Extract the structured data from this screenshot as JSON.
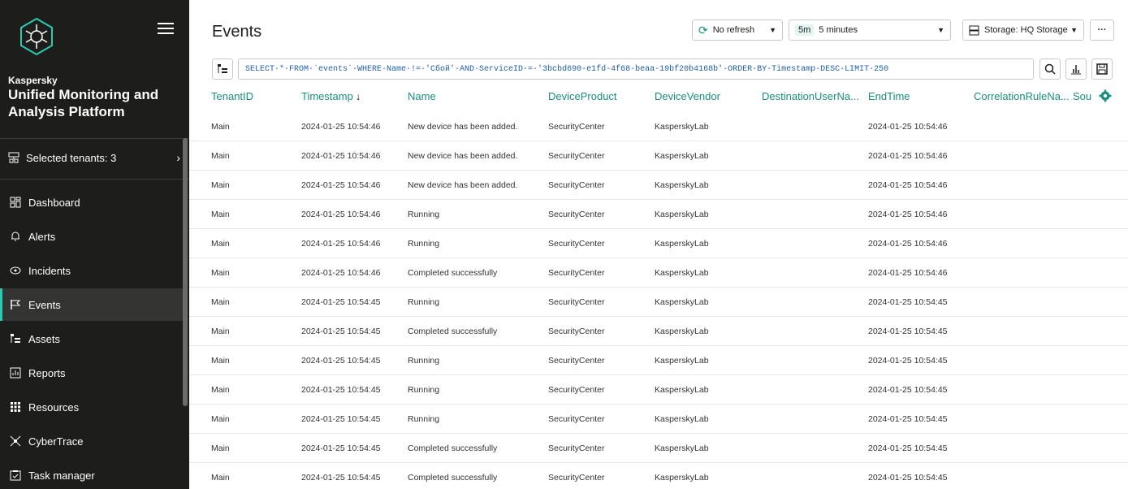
{
  "sidebar": {
    "brand": "Kaspersky",
    "product": "Unified Monitoring and Analysis Platform",
    "tenants_label": "Selected tenants: 3",
    "items": [
      {
        "label": "Dashboard",
        "icon": "dashboard-icon"
      },
      {
        "label": "Alerts",
        "icon": "bell-icon"
      },
      {
        "label": "Incidents",
        "icon": "eye-icon"
      },
      {
        "label": "Events",
        "icon": "events-icon",
        "active": true
      },
      {
        "label": "Assets",
        "icon": "assets-icon"
      },
      {
        "label": "Reports",
        "icon": "reports-icon"
      },
      {
        "label": "Resources",
        "icon": "grid-icon"
      },
      {
        "label": "CyberTrace",
        "icon": "cybertrace-icon"
      },
      {
        "label": "Task manager",
        "icon": "task-icon"
      }
    ]
  },
  "header": {
    "title": "Events",
    "refresh_label": "No refresh",
    "period_badge": "5m",
    "period_label": "5 minutes",
    "storage_label": "Storage: HQ Storage"
  },
  "query": "SELECT·*·FROM·`events`·WHERE·Name·!=·'Сбой'·AND·ServiceID·=·'3bcbd690-e1fd-4f68-beaa-19bf20b4168b'·ORDER·BY·Timestamp·DESC·LIMIT·250",
  "table": {
    "columns": [
      "TenantID",
      "Timestamp",
      "Name",
      "DeviceProduct",
      "DeviceVendor",
      "DestinationUserNa...",
      "EndTime",
      "CorrelationRuleNa...",
      "Sou"
    ],
    "sort_indicator": "↓",
    "rows": [
      [
        "Main",
        "2024-01-25 10:54:46",
        "New device has been added.",
        "SecurityCenter",
        "KasperskyLab",
        "",
        "2024-01-25 10:54:46",
        "",
        ""
      ],
      [
        "Main",
        "2024-01-25 10:54:46",
        "New device has been added.",
        "SecurityCenter",
        "KasperskyLab",
        "",
        "2024-01-25 10:54:46",
        "",
        ""
      ],
      [
        "Main",
        "2024-01-25 10:54:46",
        "New device has been added.",
        "SecurityCenter",
        "KasperskyLab",
        "",
        "2024-01-25 10:54:46",
        "",
        ""
      ],
      [
        "Main",
        "2024-01-25 10:54:46",
        "Running",
        "SecurityCenter",
        "KasperskyLab",
        "",
        "2024-01-25 10:54:46",
        "",
        ""
      ],
      [
        "Main",
        "2024-01-25 10:54:46",
        "Running",
        "SecurityCenter",
        "KasperskyLab",
        "",
        "2024-01-25 10:54:46",
        "",
        ""
      ],
      [
        "Main",
        "2024-01-25 10:54:46",
        "Completed successfully",
        "SecurityCenter",
        "KasperskyLab",
        "",
        "2024-01-25 10:54:46",
        "",
        ""
      ],
      [
        "Main",
        "2024-01-25 10:54:45",
        "Running",
        "SecurityCenter",
        "KasperskyLab",
        "",
        "2024-01-25 10:54:45",
        "",
        ""
      ],
      [
        "Main",
        "2024-01-25 10:54:45",
        "Completed successfully",
        "SecurityCenter",
        "KasperskyLab",
        "",
        "2024-01-25 10:54:45",
        "",
        ""
      ],
      [
        "Main",
        "2024-01-25 10:54:45",
        "Running",
        "SecurityCenter",
        "KasperskyLab",
        "",
        "2024-01-25 10:54:45",
        "",
        ""
      ],
      [
        "Main",
        "2024-01-25 10:54:45",
        "Running",
        "SecurityCenter",
        "KasperskyLab",
        "",
        "2024-01-25 10:54:45",
        "",
        ""
      ],
      [
        "Main",
        "2024-01-25 10:54:45",
        "Running",
        "SecurityCenter",
        "KasperskyLab",
        "",
        "2024-01-25 10:54:45",
        "",
        ""
      ],
      [
        "Main",
        "2024-01-25 10:54:45",
        "Completed successfully",
        "SecurityCenter",
        "KasperskyLab",
        "",
        "2024-01-25 10:54:45",
        "",
        ""
      ],
      [
        "Main",
        "2024-01-25 10:54:45",
        "Completed successfully",
        "SecurityCenter",
        "KasperskyLab",
        "",
        "2024-01-25 10:54:45",
        "",
        ""
      ]
    ]
  },
  "colors": {
    "sidebar_bg": "#1d1d1b",
    "accent": "#29ccb1",
    "header_text": "#1a8f7e",
    "query_text": "#1f5fa8"
  }
}
